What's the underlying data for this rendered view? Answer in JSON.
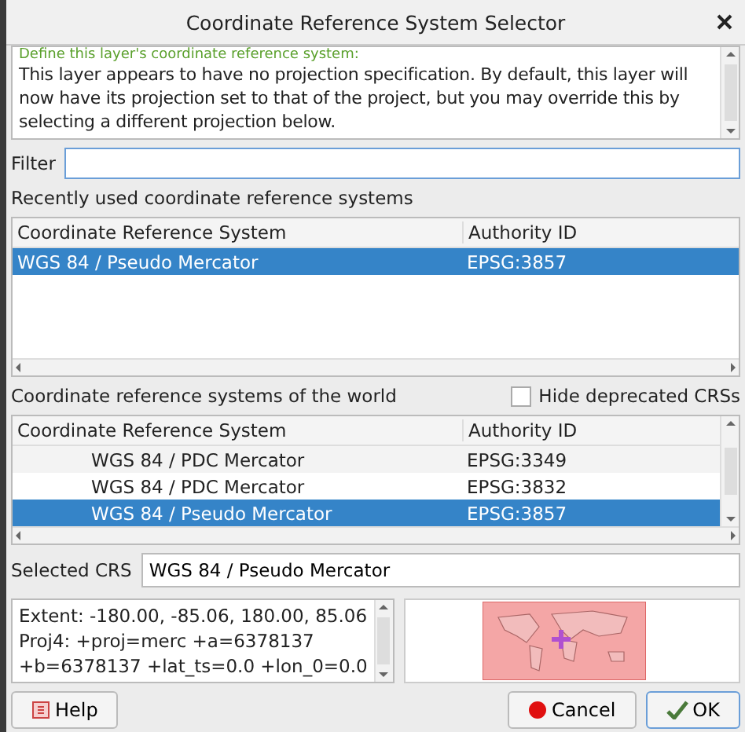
{
  "window": {
    "title": "Coordinate Reference System Selector"
  },
  "info": {
    "heading": "Define this layer's coordinate reference system:",
    "text": "This layer appears to have no projection specification. By default, this layer will now have its projection set to that of the project, but you may override this by selecting a different projection below."
  },
  "filter": {
    "label": "Filter"
  },
  "recent": {
    "label": "Recently used coordinate reference systems",
    "columns": [
      "Coordinate Reference System",
      "Authority ID"
    ],
    "rows": [
      {
        "name": "WGS 84 / Pseudo Mercator",
        "id": "EPSG:3857",
        "selected": true
      }
    ]
  },
  "world": {
    "label": "Coordinate reference systems of the world",
    "hide_deprecated": {
      "label": "Hide deprecated CRSs",
      "checked": false
    },
    "columns": [
      "Coordinate Reference System",
      "Authority ID"
    ],
    "rows": [
      {
        "name": "WGS 84 / PDC Mercator",
        "id": "EPSG:3349",
        "selected": false
      },
      {
        "name": "WGS 84 / PDC Mercator",
        "id": "EPSG:3832",
        "selected": false
      },
      {
        "name": "WGS 84 / Pseudo Mercator",
        "id": "EPSG:3857",
        "selected": true
      }
    ]
  },
  "selected_crs": {
    "label": "Selected CRS",
    "value": "WGS 84 / Pseudo Mercator"
  },
  "details": [
    "Extent: -180.00, -85.06, 180.00, 85.06",
    "Proj4: +proj=merc +a=6378137",
    "+b=6378137 +lat_ts=0.0 +lon_0=0.0"
  ],
  "buttons": {
    "help": "Help",
    "cancel": "Cancel",
    "ok": "OK"
  }
}
